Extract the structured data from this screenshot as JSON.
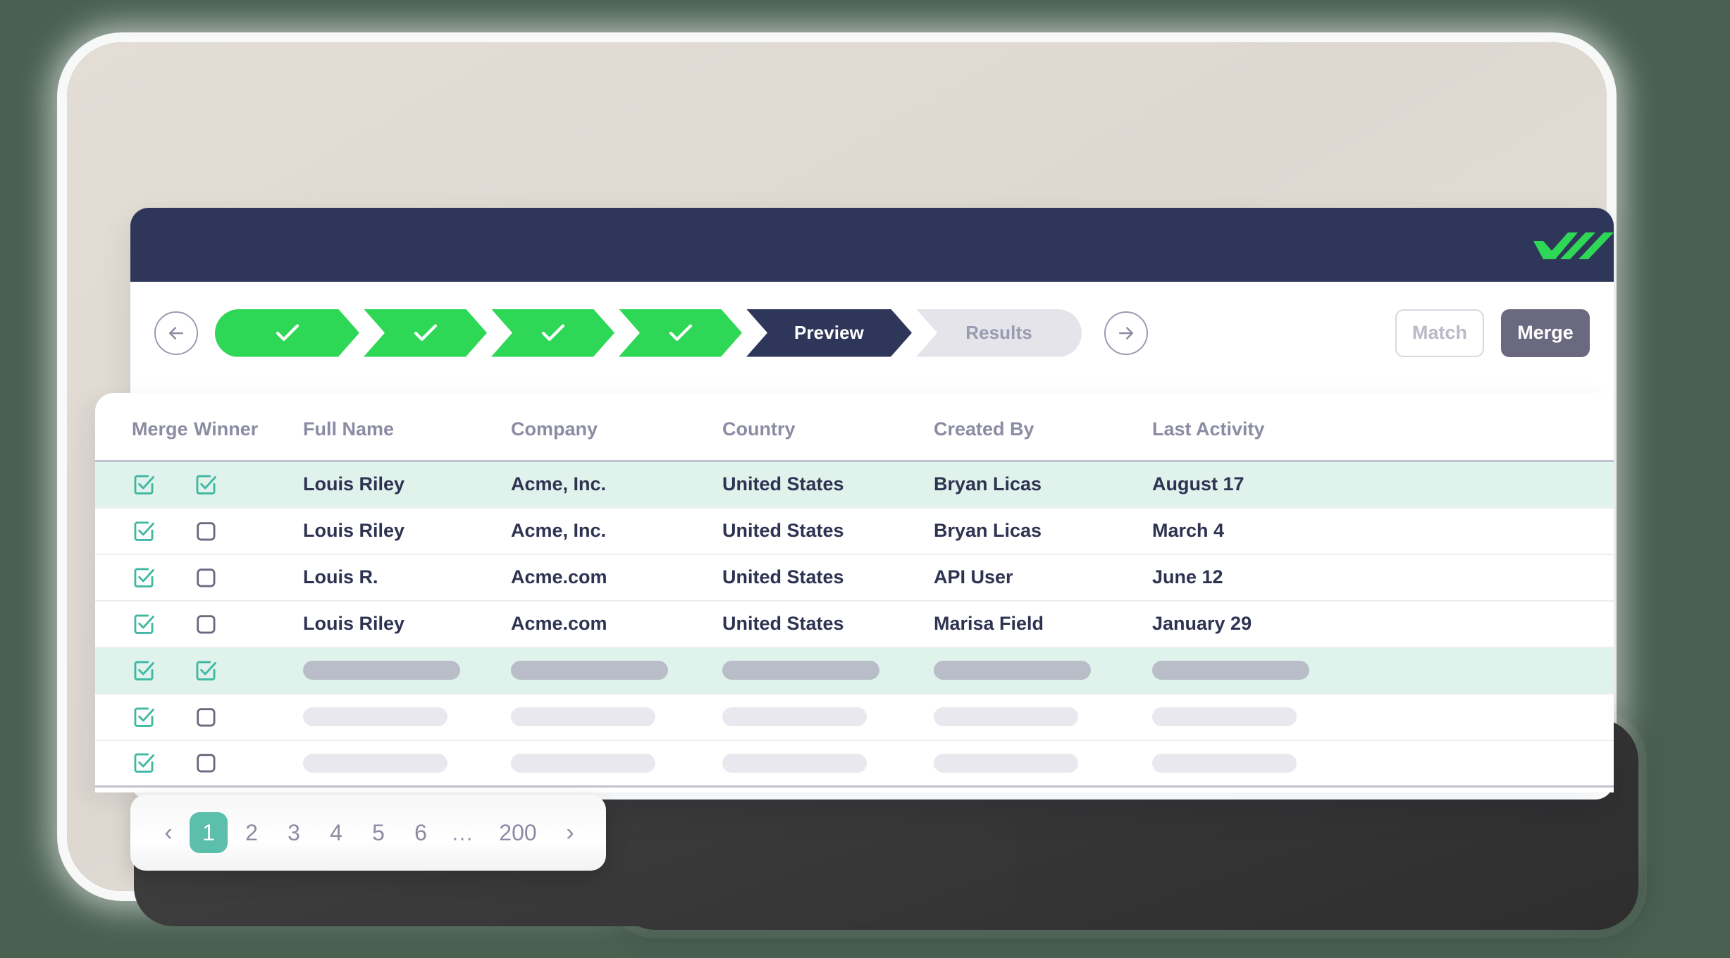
{
  "brand": {
    "logo_icon": "wide-chevrons-logo",
    "header_bg": "#2e3759",
    "accent_green": "#2ed756",
    "accent_teal": "#5bbfac",
    "merge_button_bg": "#6b697f"
  },
  "toolbar": {
    "back_icon": "arrow-left-icon",
    "next_icon": "arrow-right-icon",
    "match_label": "Match",
    "merge_label": "Merge",
    "steps": [
      {
        "label": "",
        "state": "done",
        "icon": "check-icon"
      },
      {
        "label": "",
        "state": "done",
        "icon": "check-icon"
      },
      {
        "label": "",
        "state": "done",
        "icon": "check-icon"
      },
      {
        "label": "",
        "state": "done",
        "icon": "check-icon"
      },
      {
        "label": "Preview",
        "state": "current",
        "icon": ""
      },
      {
        "label": "Results",
        "state": "todo",
        "icon": ""
      }
    ]
  },
  "table": {
    "columns": [
      "Merge",
      "Winner",
      "Full Name",
      "Company",
      "Country",
      "Created By",
      "Last Activity"
    ],
    "rows": [
      {
        "merge": true,
        "winner": true,
        "highlight": true,
        "skeleton": false,
        "full_name": "Louis Riley",
        "company": "Acme, Inc.",
        "country": "United States",
        "created_by": "Bryan Licas",
        "last_activity": "August 17"
      },
      {
        "merge": true,
        "winner": false,
        "highlight": false,
        "skeleton": false,
        "full_name": "Louis Riley",
        "company": "Acme, Inc.",
        "country": "United States",
        "created_by": "Bryan Licas",
        "last_activity": "March 4"
      },
      {
        "merge": true,
        "winner": false,
        "highlight": false,
        "skeleton": false,
        "full_name": "Louis R.",
        "company": "Acme.com",
        "country": "United States",
        "created_by": "API User",
        "last_activity": "June 12"
      },
      {
        "merge": true,
        "winner": false,
        "highlight": false,
        "skeleton": false,
        "full_name": "Louis Riley",
        "company": "Acme.com",
        "country": "United States",
        "created_by": "Marisa Field",
        "last_activity": "January 29"
      },
      {
        "merge": true,
        "winner": true,
        "highlight": true,
        "skeleton": true,
        "full_name": "",
        "company": "",
        "country": "",
        "created_by": "",
        "last_activity": ""
      },
      {
        "merge": true,
        "winner": false,
        "highlight": false,
        "skeleton": true,
        "full_name": "",
        "company": "",
        "country": "",
        "created_by": "",
        "last_activity": ""
      },
      {
        "merge": true,
        "winner": false,
        "highlight": false,
        "skeleton": true,
        "full_name": "",
        "company": "",
        "country": "",
        "created_by": "",
        "last_activity": ""
      }
    ]
  },
  "pagination": {
    "prev_icon": "chevron-left-icon",
    "next_icon": "chevron-right-icon",
    "current_page": "1",
    "pages": [
      "1",
      "2",
      "3",
      "4",
      "5",
      "6",
      "…",
      "200"
    ]
  }
}
